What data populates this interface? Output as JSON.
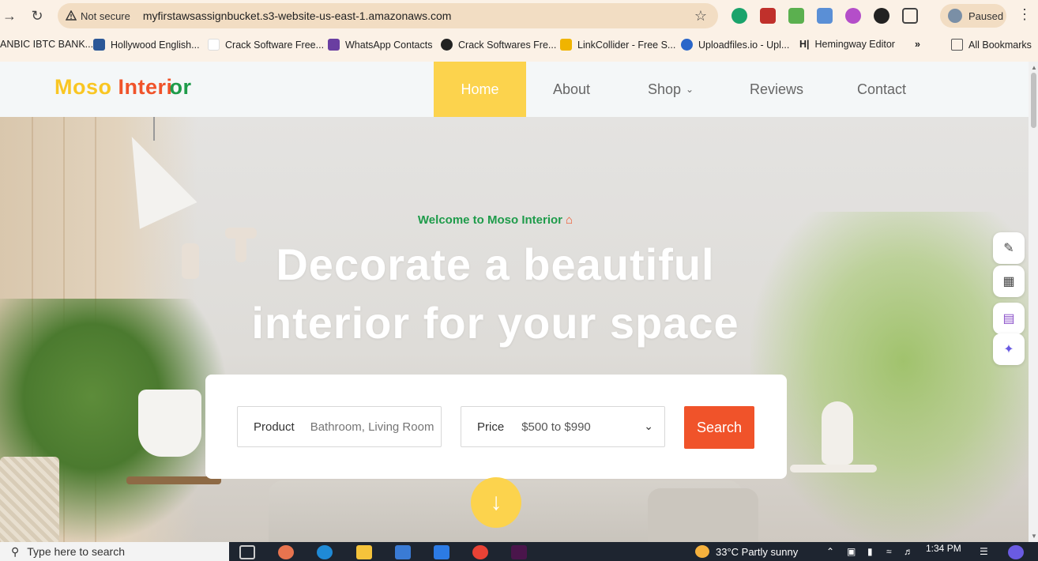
{
  "browser": {
    "security_label": "Not secure",
    "url": "myfirstawsassignbucket.s3-website-us-east-1.amazonaws.com",
    "profile_status": "Paused"
  },
  "bookmarks": [
    {
      "label": "ANBIC IBTC BANK...",
      "color": "#1a4fa3"
    },
    {
      "label": "Hollywood English...",
      "color": "#2b5797"
    },
    {
      "label": "Crack Software Free...",
      "color": "#ffffff"
    },
    {
      "label": "WhatsApp Contacts",
      "color": "#6a3ea1"
    },
    {
      "label": "Crack Softwares Fre...",
      "color": "#222222"
    },
    {
      "label": "LinkCollider - Free S...",
      "color": "#f0b400"
    },
    {
      "label": "Uploadfiles.io - Upl...",
      "color": "#2a66c9"
    },
    {
      "label": "Hemingway Editor",
      "color": "#333333"
    },
    {
      "label": "All Bookmarks",
      "color": "#555555"
    }
  ],
  "site": {
    "logo": {
      "part1": "Moso",
      "part2": "Interi",
      "part3": "or"
    },
    "nav": {
      "home": "Home",
      "about": "About",
      "shop": "Shop",
      "reviews": "Reviews",
      "contact": "Contact"
    },
    "hero": {
      "welcome": "Welcome to Moso Interior",
      "headline_line1": "Decorate a beautiful",
      "headline_line2": "interior for your space"
    },
    "search": {
      "product_label": "Product",
      "product_placeholder": "Bathroom, Living Room",
      "price_label": "Price",
      "price_value": "$500 to $990",
      "button_label": "Search"
    }
  },
  "taskbar": {
    "search_placeholder": "Type here to search",
    "weather": "33°C  Partly sunny",
    "time": "1:34 PM"
  },
  "colors": {
    "accent_yellow": "#fcd34d",
    "accent_orange": "#f0532a",
    "accent_green": "#1e9b4a"
  }
}
